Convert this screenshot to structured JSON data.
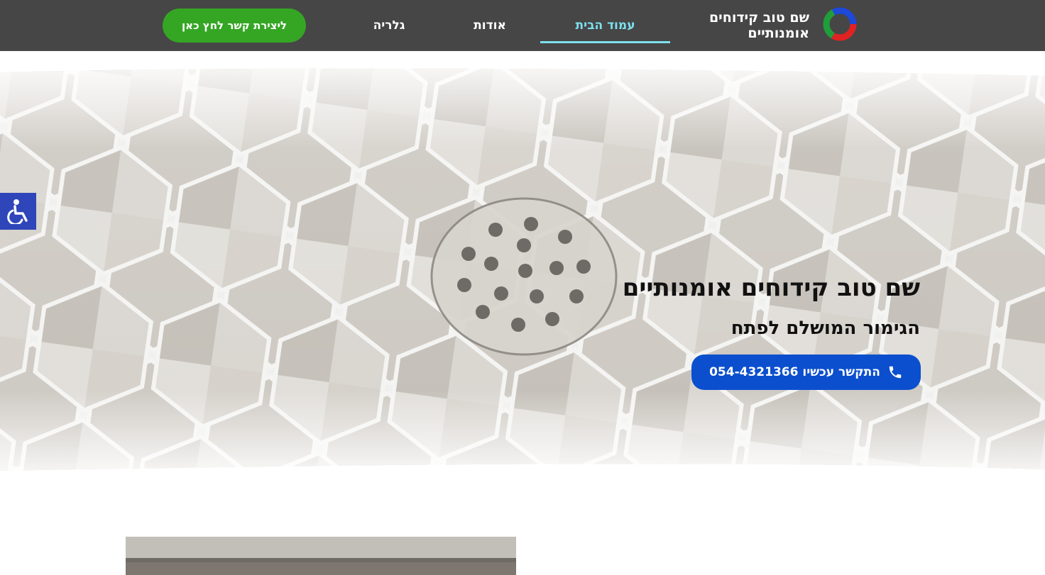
{
  "header": {
    "site_title": "שם טוב קידוחים אומנותיים",
    "nav": [
      {
        "label": "עמוד הבית",
        "active": true
      },
      {
        "label": "אודות",
        "active": false
      },
      {
        "label": "גלריה",
        "active": false
      }
    ],
    "cta_label": "ליצירת קשר לחץ כאן"
  },
  "hero": {
    "heading": "שם טוב קידוחים אומנותיים",
    "subheading": "הגימור המושלם לפתח",
    "call_button_label": "התקשר עכשיו 054-4321366",
    "background": "hexagonal-tile-floor-with-drain-image"
  },
  "accessibility": {
    "icon": "wheelchair-icon"
  },
  "colors": {
    "header_bg": "#464646",
    "active_nav": "#7ee0ee",
    "cta_green": "#35a624",
    "call_blue": "#0b4fce",
    "accessibility_blue": "#2f45ba"
  }
}
